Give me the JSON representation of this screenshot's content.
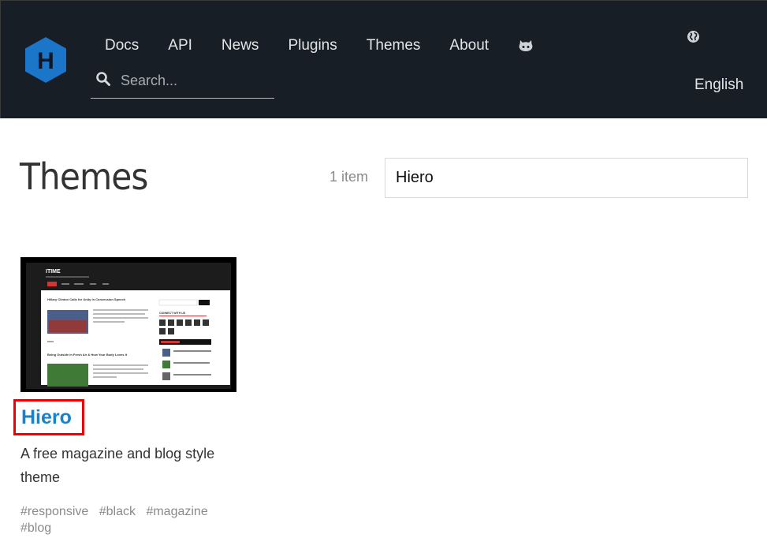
{
  "nav": {
    "items": [
      {
        "label": "Docs"
      },
      {
        "label": "API"
      },
      {
        "label": "News"
      },
      {
        "label": "Plugins"
      },
      {
        "label": "Themes"
      },
      {
        "label": "About"
      }
    ],
    "github_icon": "github-octocat-icon",
    "search_placeholder": "Search...",
    "language": "English",
    "globe_icon": "globe-icon",
    "logo_letter": "H"
  },
  "main": {
    "title": "Themes",
    "count": "1 item",
    "filter_value": "Hiero"
  },
  "card": {
    "title": "Hiero",
    "description": "A free magazine and blog style theme",
    "tags": [
      "#responsive",
      "#black",
      "#magazine",
      "#blog"
    ],
    "thumbnail": {
      "site_title": "ITIME",
      "post1_title": "Hillary Clinton Calls for Unity in Concession Speech",
      "post2_title": "Being Outside in Fresh Air & How Your Body Loves It",
      "sidebar_heading": "CONNECT WITH US",
      "button": "SEARCH"
    }
  },
  "colors": {
    "header_bg": "#171e26",
    "logo": "#1b75c9",
    "link": "#1a82c8",
    "highlight_border": "#ee0000"
  }
}
